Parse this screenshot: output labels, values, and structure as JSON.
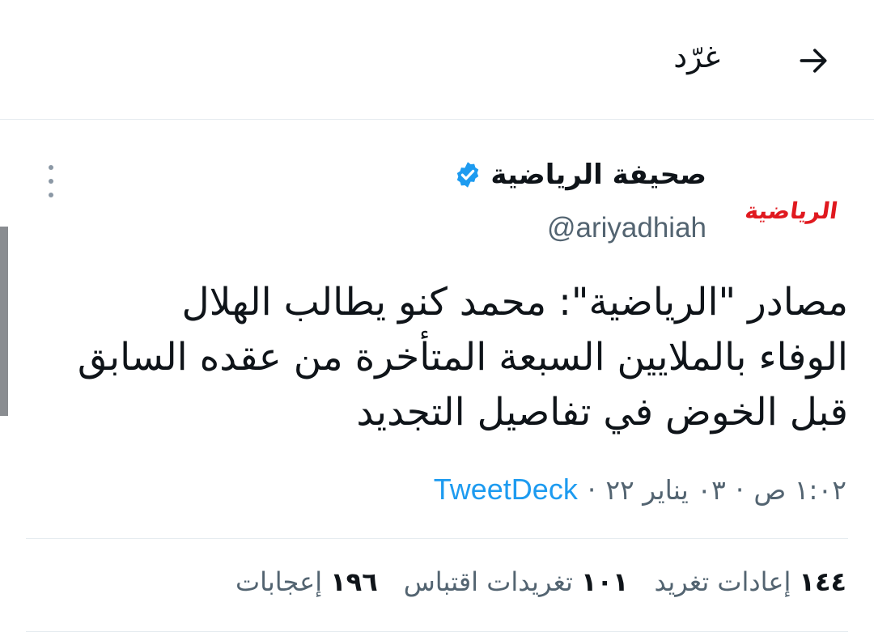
{
  "header": {
    "title": "غرّد",
    "back_icon": "arrow-back-icon"
  },
  "author": {
    "avatar_text": "الرياضية",
    "display_name": "صحيفة الرياضية",
    "verified_icon": "verified-badge-icon",
    "handle": "@ariyadhiah",
    "more_icon": "more-vertical-icon"
  },
  "tweet": {
    "lines": [
      "مصادر \"الرياضية\": محمد كنو يطالب الهلال",
      "الوفاء بالملايين السبعة المتأخرة من عقده السابق",
      "قبل الخوض في تفاصيل التجديد"
    ]
  },
  "meta": {
    "time": "١:٠٢ ص",
    "date": "٠٣ يناير ٢٢",
    "source": "TweetDeck",
    "separator": "·"
  },
  "stats": {
    "retweets_count": "١٤٤",
    "retweets_label": "إعادات تغريد",
    "quotes_count": "١٠١",
    "quotes_label": "تغريدات اقتباس",
    "likes_count": "١٩٦",
    "likes_label": "إعجابات"
  },
  "colors": {
    "link": "#1d9bf0",
    "secondary_text": "#536471",
    "brand_red": "#e0191f",
    "verified": "#1d9bf0"
  }
}
